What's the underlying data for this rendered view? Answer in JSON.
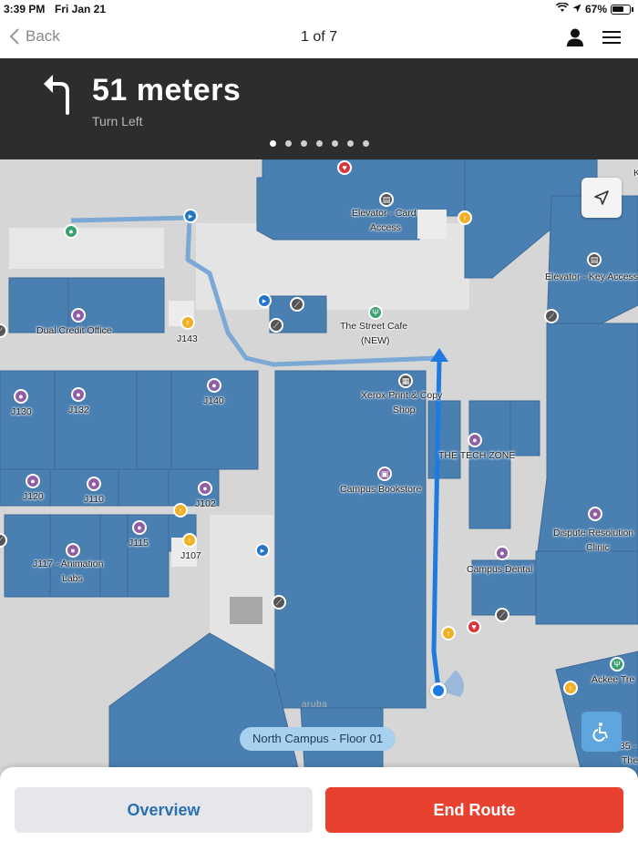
{
  "status_bar": {
    "time": "3:39 PM",
    "date": "Fri Jan 21",
    "battery": "67%"
  },
  "nav": {
    "back_label": "Back",
    "title": "1 of 7"
  },
  "banner": {
    "distance": "51 meters",
    "instruction": "Turn Left",
    "step_count": 7,
    "active_step": 1
  },
  "map": {
    "floor_label": "North Campus - Floor 01",
    "watermark": "aruba",
    "labels": {
      "elevator_card_1": "Elevator - Card",
      "elevator_card_2": "Access",
      "elevator_key": "Elevator - Key Access",
      "dual_credit": "Dual Credit Office",
      "j143": "J143",
      "street_cafe_1": "The Street Cafe",
      "street_cafe_2": "(NEW)",
      "xerox_1": "Xerox Print & Copy",
      "xerox_2": "Shop",
      "j130": "J130",
      "j132": "J132",
      "j140": "J140",
      "tech_zone": "THE TECH ZONE",
      "bookstore": "Campus Bookstore",
      "j120": "J120",
      "j110": "J110",
      "j102": "J102",
      "dispute_1": "Dispute Resolution",
      "dispute_2": "Clinic",
      "j115": "J115",
      "j107": "J107",
      "j117_1": "J117 - Animation",
      "j117_2": "Labs",
      "dental": "Campus Dental",
      "ackee": "Ackee Tre",
      "edge_k": "K",
      "edge_35": ".35 -",
      "edge_the": "The"
    }
  },
  "actions": {
    "overview_label": "Overview",
    "end_route_label": "End Route"
  },
  "colors": {
    "room_blue": "#4a7fb1",
    "route_blue": "#1f7ae0",
    "end_route_red": "#e8412f",
    "banner_bg": "#2d2d2d"
  }
}
